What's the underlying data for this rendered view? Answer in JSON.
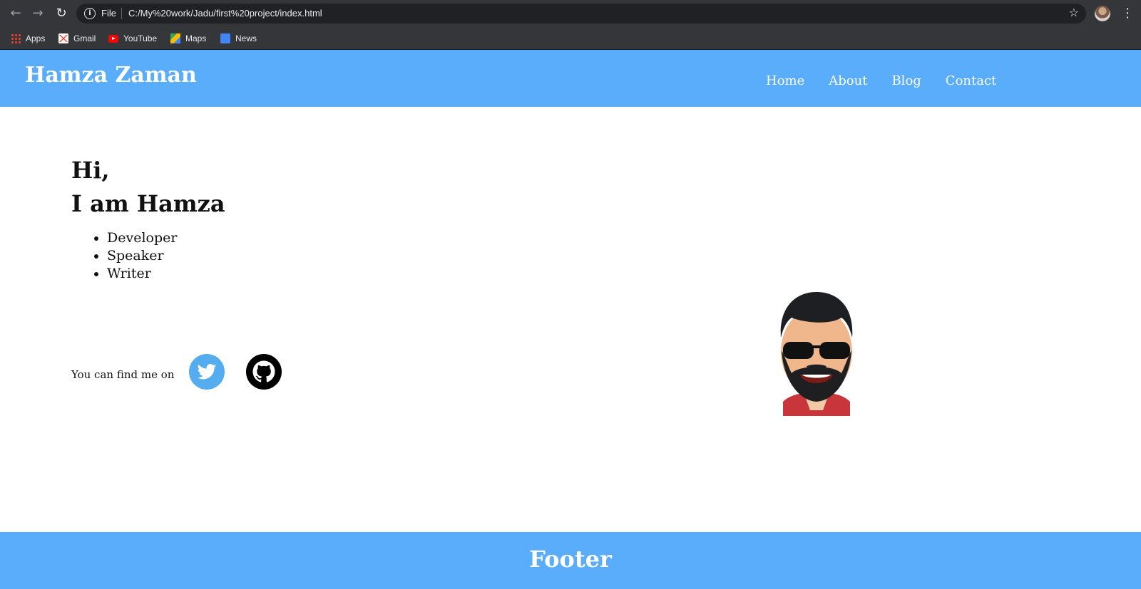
{
  "browser": {
    "back_icon": "arrow-left-icon",
    "forward_icon": "arrow-right-icon",
    "reload_icon": "reload-icon",
    "site_info_label": "File",
    "url": "C:/My%20work/Jadu/first%20project/index.html",
    "bookmarks": [
      {
        "label": "Apps",
        "icon": "apps-grid-icon"
      },
      {
        "label": "Gmail",
        "icon": "gmail-icon"
      },
      {
        "label": "YouTube",
        "icon": "youtube-icon"
      },
      {
        "label": "Maps",
        "icon": "maps-icon"
      },
      {
        "label": "News",
        "icon": "news-icon"
      }
    ]
  },
  "header": {
    "brand": "Hamza Zaman",
    "nav": [
      "Home",
      "About",
      "Blog",
      "Contact"
    ],
    "background": "#5aadfb"
  },
  "main": {
    "greeting": "Hi,",
    "intro": "I am Hamza",
    "roles": [
      "Developer",
      "Speaker",
      "Writer"
    ],
    "find_me_text": "You can find me on",
    "social": [
      {
        "name": "Twitter",
        "icon": "twitter-icon",
        "color": "#55acee"
      },
      {
        "name": "GitHub",
        "icon": "github-icon",
        "color": "#000000"
      }
    ],
    "avatar": "cartoon-avatar-with-sunglasses"
  },
  "footer": {
    "title": "Footer",
    "background": "#5aadfb"
  }
}
